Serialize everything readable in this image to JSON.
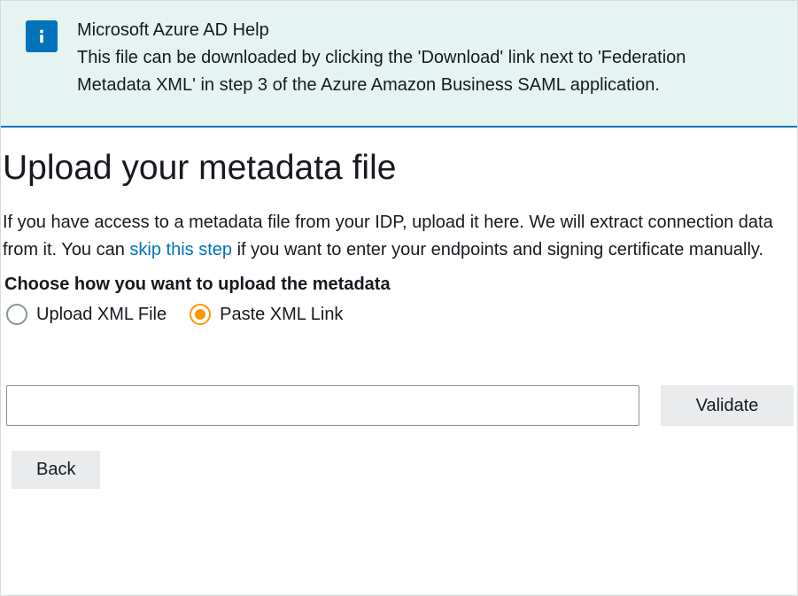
{
  "info": {
    "title": "Microsoft Azure AD Help",
    "body": "This file can be downloaded by clicking the 'Download' link next to 'Federation Metadata XML' in step 3 of the Azure Amazon Business SAML application."
  },
  "page": {
    "title": "Upload your metadata file",
    "description_pre": "If you have access to a metadata file from your IDP, upload it here. We will extract connection data from it. You can ",
    "skip_link": "skip this step",
    "description_post": " if you want to enter your endpoints and signing certificate manually.",
    "choose_label": "Choose how you want to upload the metadata"
  },
  "radios": {
    "upload_xml": "Upload XML File",
    "paste_link": "Paste XML Link",
    "selected": "paste_link"
  },
  "input": {
    "value": ""
  },
  "buttons": {
    "validate": "Validate",
    "back": "Back"
  }
}
